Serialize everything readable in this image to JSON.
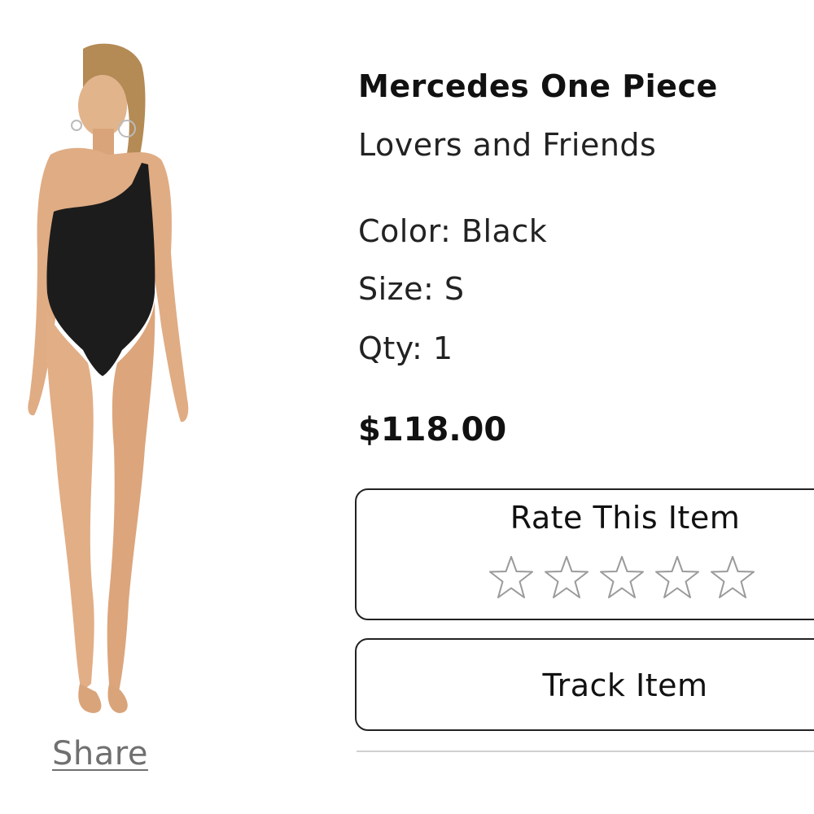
{
  "product": {
    "name": "Mercedes One Piece",
    "brand": "Lovers and Friends",
    "color": "Color: Black",
    "size": "Size: S",
    "qty": "Qty: 1",
    "price": "$118.00",
    "image_alt": "model wearing black one-shoulder swimsuit"
  },
  "share": {
    "label": "Share"
  },
  "rating": {
    "title": "Rate This Item",
    "max_stars": 5,
    "current": 0,
    "star_icon": "star-outline-icon"
  },
  "track": {
    "label": "Track Item"
  },
  "colors": {
    "text": "#111111",
    "link": "#707070",
    "border": "#222222",
    "star_outline": "#9a9a9a",
    "divider": "#d0d0d0"
  }
}
